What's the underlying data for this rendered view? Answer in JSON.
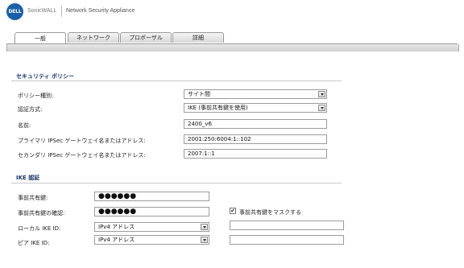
{
  "header": {
    "logo_text": "DELL",
    "brand": "SonicWALL",
    "product": "Network Security Appliance"
  },
  "tabs": [
    {
      "label": "一般",
      "active": true
    },
    {
      "label": "ネットワーク",
      "active": false
    },
    {
      "label": "プロポーザル",
      "active": false
    },
    {
      "label": "詳細",
      "active": false
    }
  ],
  "security_policy": {
    "title": "セキュリティ ポリシー",
    "policy_type": {
      "label": "ポリシー種別:",
      "value": "サイト間"
    },
    "auth_method": {
      "label": "認証方式:",
      "value": "IKE (事前共有鍵を使用)"
    },
    "name": {
      "label": "名前:",
      "value": "2400_v6"
    },
    "primary_gateway": {
      "label": "プライマリ IPSec ゲートウェイ名またはアドレス:",
      "value": "2001:250:6004:1::102"
    },
    "secondary_gateway": {
      "label": "セカンダリ IPSec ゲートウェイ名またはアドレス:",
      "value": "2007:1::1"
    }
  },
  "ike_auth": {
    "title": "IKE 認証",
    "shared_secret": {
      "label": "事前共有鍵:",
      "value": "●●●●●●"
    },
    "confirm_secret": {
      "label": "事前共有鍵の確認:",
      "value": "●●●●●●"
    },
    "mask_checkbox": {
      "label": "事前共有鍵をマスクする",
      "checked": true,
      "mark": "✔"
    },
    "local_ike_id": {
      "label": "ローカル IKE ID:",
      "value": "IPv4 アドレス"
    },
    "peer_ike_id": {
      "label": "ピア IKE ID:",
      "value": "IPv4 アドレス"
    }
  }
}
